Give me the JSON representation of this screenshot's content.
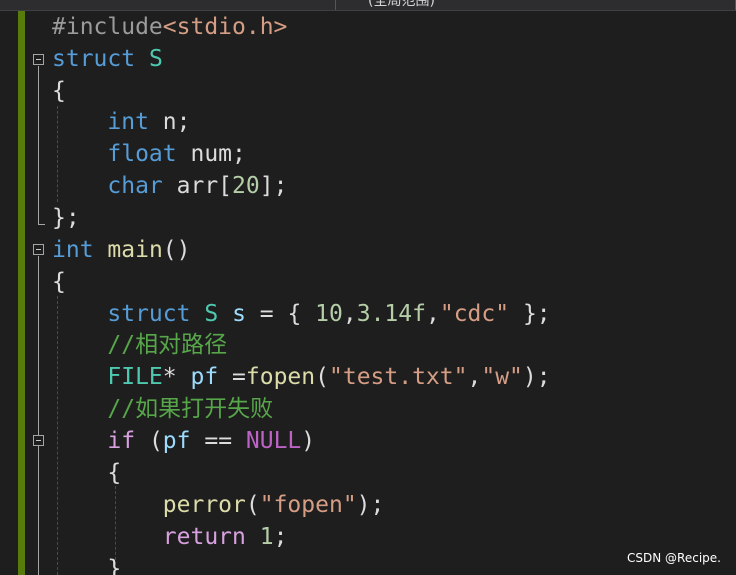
{
  "header": {
    "scope_label": "(全局范围)"
  },
  "code": {
    "l1": {
      "pp": "#include",
      "hdr": "<stdio.h>"
    },
    "l2": {
      "kw": "struct",
      "name": "S"
    },
    "l3": {
      "brace": "{"
    },
    "l4": {
      "kw": "int",
      "rest": " n;"
    },
    "l5": {
      "kw": "float",
      "rest": " num;"
    },
    "l6": {
      "kw": "char",
      "rest": " arr[",
      "num": "20",
      "end": "];"
    },
    "l7": {
      "brace": "};"
    },
    "l8": {
      "kw": "int",
      "fn": "main",
      "rest": "()"
    },
    "l9": {
      "brace": "{"
    },
    "l10": {
      "kw": "struct",
      "ty": "S",
      "var": "s",
      "eq": " = { ",
      "n1": "10",
      "c1": ",",
      "n2": "3.14f",
      "c2": ",",
      "str": "\"cdc\"",
      "end": " };"
    },
    "l11": {
      "comment": "//相对路径"
    },
    "l12": {
      "ty": "FILE",
      "p1": "* ",
      "var": "pf",
      "p2": " =",
      "fn": "fopen",
      "p3": "(",
      "s1": "\"test.txt\"",
      "p4": ",",
      "s2": "\"w\"",
      "p5": ");"
    },
    "l13": {
      "comment": "//如果打开失败"
    },
    "l14": {
      "kw": "if",
      "p1": " (",
      "var": "pf",
      "p2": " == ",
      "mac": "NULL",
      "p3": ")"
    },
    "l15": {
      "brace": "{"
    },
    "l16": {
      "fn": "perror",
      "p1": "(",
      "str": "\"fopen\"",
      "p2": ");"
    },
    "l17": {
      "kw": "return",
      "sp": " ",
      "num": "1",
      "p": ";"
    },
    "l18": {
      "brace": "}"
    }
  },
  "watermark": "CSDN @Recipe.",
  "colors": {
    "background": "#1e1e1e",
    "keyword": "#569cd6",
    "type": "#4ec9b0",
    "function": "#dcdcaa",
    "string": "#d69d85",
    "number": "#b5cea8",
    "comment": "#57a64a",
    "change_bar": "#587c0c"
  },
  "icons": {
    "fold": "fold-collapse-icon"
  }
}
